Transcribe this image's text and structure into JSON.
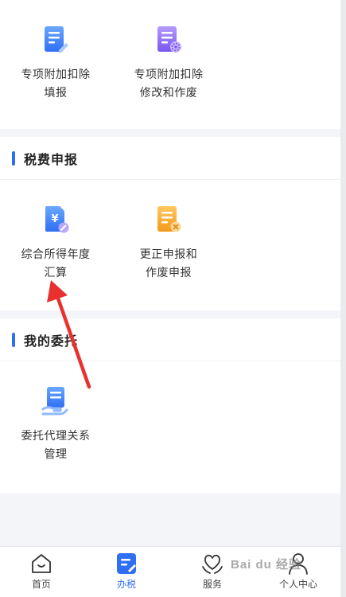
{
  "section_top": {
    "items": [
      {
        "label": "专项附加扣除\n填报",
        "icon": "form-edit-icon"
      },
      {
        "label": "专项附加扣除\n修改和作废",
        "icon": "form-settings-icon"
      }
    ]
  },
  "section_tax": {
    "title": "税费申报",
    "items": [
      {
        "label": "综合所得年度\n汇算",
        "icon": "yuan-document-icon"
      },
      {
        "label": "更正申报和\n作废申报",
        "icon": "document-cancel-icon"
      }
    ]
  },
  "section_delegation": {
    "title": "我的委托",
    "items": [
      {
        "label": "委托代理关系\n管理",
        "icon": "delegation-hand-icon"
      }
    ]
  },
  "tabbar": {
    "tabs": [
      {
        "label": "首页",
        "icon": "home-icon",
        "active": false
      },
      {
        "label": "办税",
        "icon": "tax-edit-icon",
        "active": true
      },
      {
        "label": "服务",
        "icon": "heart-hands-icon",
        "active": false
      },
      {
        "label": "个人中心",
        "icon": "person-icon",
        "active": false
      }
    ]
  },
  "watermark": {
    "text": "Bai du 经验"
  },
  "colors": {
    "accent": "#2f6ff3",
    "purple": "#8c6cf0",
    "orange": "#f5a623",
    "annotation_arrow": "#e8312f"
  }
}
